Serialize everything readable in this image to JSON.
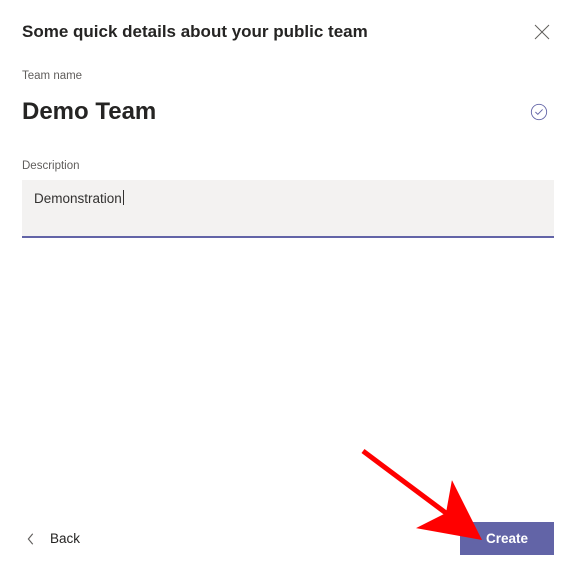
{
  "dialog": {
    "title": "Some quick details about your public team"
  },
  "fields": {
    "teamName": {
      "label": "Team name",
      "value": "Demo Team"
    },
    "description": {
      "label": "Description",
      "value": "Demonstration"
    }
  },
  "actions": {
    "back": "Back",
    "create": "Create"
  },
  "colors": {
    "accent": "#6264a7"
  }
}
